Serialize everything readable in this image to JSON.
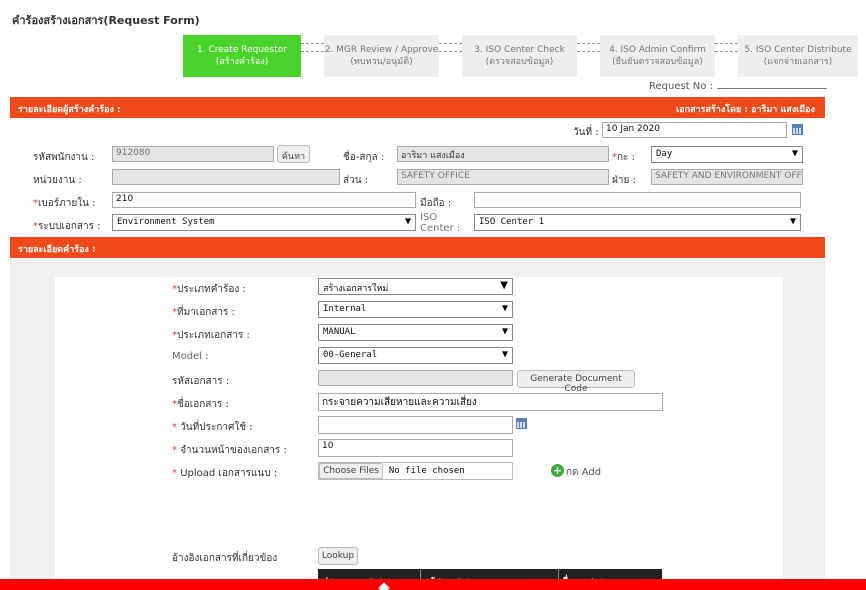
{
  "page": {
    "title": "คำร้องสร้างเอกสาร(Request Form)"
  },
  "steps": [
    {
      "line1": "1. Create Requestor",
      "line2": "(สร้างคำร้อง)"
    },
    {
      "line1": "2. MGR Review / Approve",
      "line2": "(ทบทวน/อนุมัติ)"
    },
    {
      "line1": "3. ISO Center Check",
      "line2": "(ตรวจสอบข้อมูล)"
    },
    {
      "line1": "4. ISO Admin Confirm",
      "line2": "(ยืนยันตรวจสอบข้อมูล)"
    },
    {
      "line1": "5. ISO Center Distribute",
      "line2": "(แจกจ่ายเอกสาร)"
    }
  ],
  "request_no_label": "Request No :",
  "requester_section": {
    "title": "รายละเอียดผู้สร้างคำร้อง :",
    "created_by": "เอกสารสร้างโดย : อาริมา แสงเมือง",
    "date_label": "วันที่ :",
    "date_value": "10 Jan 2020",
    "employee_id_label": "รหัสพนักงาน :",
    "employee_id_value": "912080",
    "search_button": "ค้นหา",
    "name_label": "ชื่อ-สกุล :",
    "name_value": "อาริมา แสงเมือง",
    "shift_label": "กะ :",
    "shift_value": "Day",
    "unit_label": "หน่วยงาน :",
    "unit_value": "",
    "section_label": "ส่วน :",
    "section_value": "SAFETY OFFICE",
    "dept_label": "ฝ่าย :",
    "dept_value": "SAFETY AND ENVIRONMENT OFFICE",
    "ext_label": "เบอร์ภายใน :",
    "ext_value": "210",
    "mobile_label": "มือถือ :",
    "mobile_value": "",
    "system_label": "ระบบเอกสาร :",
    "system_value": "Environment System",
    "iso_center_label": "ISO Center :",
    "iso_center_value": "ISO Center 1"
  },
  "request_section": {
    "title": "รายละเอียดคำร้อง :",
    "request_type_label": "ประเภทคำร้อง :",
    "request_type_value": "สร้างเอกสารใหม่",
    "source_label": "ที่มาเอกสาร :",
    "source_value": "Internal",
    "doc_type_label": "ประเภทเอกสาร :",
    "doc_type_value": "MANUAL",
    "model_label": "Model :",
    "model_value": "00-General",
    "doc_code_label": "รหัสเอกสาร :",
    "doc_code_value": "",
    "generate_button": "Generate Document Code",
    "doc_name_label": "ชื่อเอกสาร :",
    "doc_name_value": "กระจายความเสียหายและความเสี่ยง",
    "effective_date_label": "วันที่ประกาศใช้ :",
    "effective_date_value": "",
    "pages_label": "จำนวนหน้าของเอกสาร :",
    "pages_value": "10",
    "upload_label": "Upload เอกสารแนบ :",
    "choose_files_button": "Choose Files",
    "no_file_text": "No file chosen",
    "add_label": "กด Add",
    "reference_label": "อ้างอิงเอกสารที่เกี่ยวข้อง",
    "lookup_button": "Lookup",
    "table_headers": [
      "ประเภทเอกสาร",
      "รหัสเอกสาร",
      "ชื่อเอกสาร"
    ]
  },
  "colors": {
    "accent": "#f04a1a",
    "step_active": "#4ad32a",
    "bottom_bar": "#ff0000"
  }
}
